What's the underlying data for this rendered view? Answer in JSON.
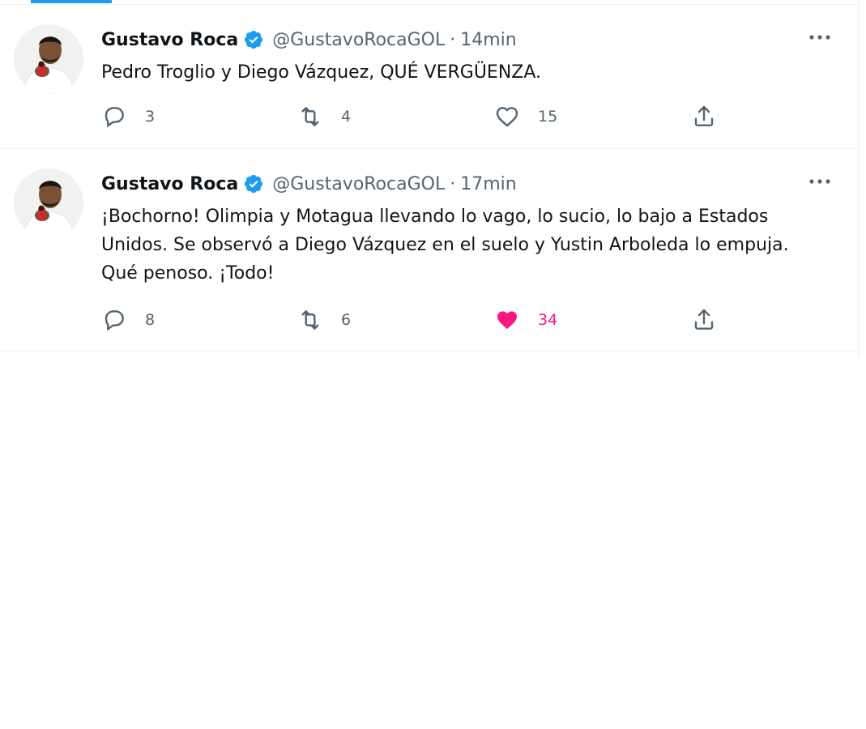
{
  "tweets": [
    {
      "author_name": "Gustavo Roca",
      "handle": "@GustavoRocaGOL",
      "separator": "·",
      "time": "14min",
      "text": "Pedro Troglio y Diego Vázquez, QUÉ VERGÜENZA.",
      "replies": "3",
      "retweets": "4",
      "likes": "15",
      "liked": false
    },
    {
      "author_name": "Gustavo Roca",
      "handle": "@GustavoRocaGOL",
      "separator": "·",
      "time": "17min",
      "text": "¡Bochorno! Olimpia y Motagua llevando lo vago, lo sucio, lo bajo a Estados Unidos. Se observó a Diego Vázquez en el suelo y Yustin Arboleda lo empuja. Qué penoso. ¡Todo!",
      "replies": "8",
      "retweets": "6",
      "likes": "34",
      "liked": true
    }
  ],
  "icons": {
    "verified": "verified-badge-icon",
    "more": "more-options-icon",
    "reply": "reply-icon",
    "retweet": "retweet-icon",
    "like": "like-heart-icon",
    "share": "share-icon"
  },
  "colors": {
    "accent": "#1d9bf0",
    "like": "#f91880",
    "muted": "#536471",
    "text": "#0f1419"
  }
}
